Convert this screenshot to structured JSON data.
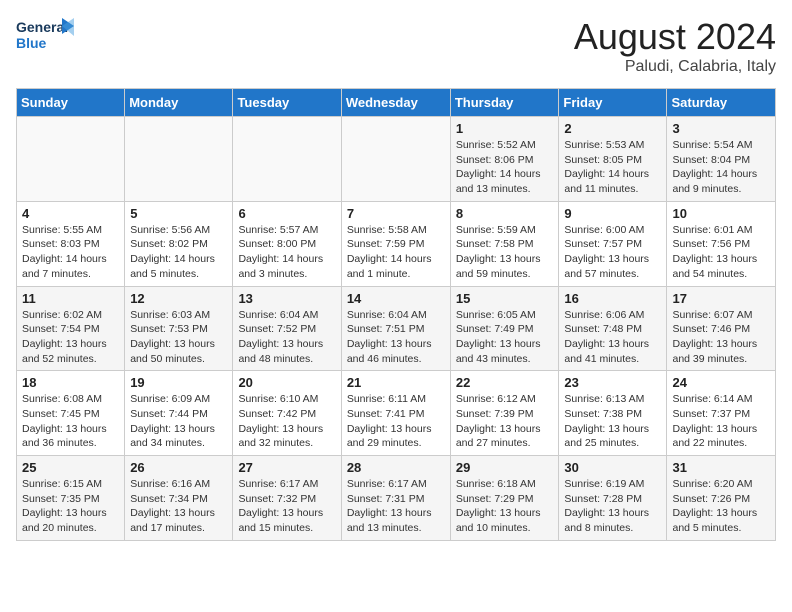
{
  "header": {
    "logo_general": "General",
    "logo_blue": "Blue",
    "month_title": "August 2024",
    "location": "Paludi, Calabria, Italy"
  },
  "weekdays": [
    "Sunday",
    "Monday",
    "Tuesday",
    "Wednesday",
    "Thursday",
    "Friday",
    "Saturday"
  ],
  "weeks": [
    [
      {
        "day": "",
        "info": ""
      },
      {
        "day": "",
        "info": ""
      },
      {
        "day": "",
        "info": ""
      },
      {
        "day": "",
        "info": ""
      },
      {
        "day": "1",
        "info": "Sunrise: 5:52 AM\nSunset: 8:06 PM\nDaylight: 14 hours\nand 13 minutes."
      },
      {
        "day": "2",
        "info": "Sunrise: 5:53 AM\nSunset: 8:05 PM\nDaylight: 14 hours\nand 11 minutes."
      },
      {
        "day": "3",
        "info": "Sunrise: 5:54 AM\nSunset: 8:04 PM\nDaylight: 14 hours\nand 9 minutes."
      }
    ],
    [
      {
        "day": "4",
        "info": "Sunrise: 5:55 AM\nSunset: 8:03 PM\nDaylight: 14 hours\nand 7 minutes."
      },
      {
        "day": "5",
        "info": "Sunrise: 5:56 AM\nSunset: 8:02 PM\nDaylight: 14 hours\nand 5 minutes."
      },
      {
        "day": "6",
        "info": "Sunrise: 5:57 AM\nSunset: 8:00 PM\nDaylight: 14 hours\nand 3 minutes."
      },
      {
        "day": "7",
        "info": "Sunrise: 5:58 AM\nSunset: 7:59 PM\nDaylight: 14 hours\nand 1 minute."
      },
      {
        "day": "8",
        "info": "Sunrise: 5:59 AM\nSunset: 7:58 PM\nDaylight: 13 hours\nand 59 minutes."
      },
      {
        "day": "9",
        "info": "Sunrise: 6:00 AM\nSunset: 7:57 PM\nDaylight: 13 hours\nand 57 minutes."
      },
      {
        "day": "10",
        "info": "Sunrise: 6:01 AM\nSunset: 7:56 PM\nDaylight: 13 hours\nand 54 minutes."
      }
    ],
    [
      {
        "day": "11",
        "info": "Sunrise: 6:02 AM\nSunset: 7:54 PM\nDaylight: 13 hours\nand 52 minutes."
      },
      {
        "day": "12",
        "info": "Sunrise: 6:03 AM\nSunset: 7:53 PM\nDaylight: 13 hours\nand 50 minutes."
      },
      {
        "day": "13",
        "info": "Sunrise: 6:04 AM\nSunset: 7:52 PM\nDaylight: 13 hours\nand 48 minutes."
      },
      {
        "day": "14",
        "info": "Sunrise: 6:04 AM\nSunset: 7:51 PM\nDaylight: 13 hours\nand 46 minutes."
      },
      {
        "day": "15",
        "info": "Sunrise: 6:05 AM\nSunset: 7:49 PM\nDaylight: 13 hours\nand 43 minutes."
      },
      {
        "day": "16",
        "info": "Sunrise: 6:06 AM\nSunset: 7:48 PM\nDaylight: 13 hours\nand 41 minutes."
      },
      {
        "day": "17",
        "info": "Sunrise: 6:07 AM\nSunset: 7:46 PM\nDaylight: 13 hours\nand 39 minutes."
      }
    ],
    [
      {
        "day": "18",
        "info": "Sunrise: 6:08 AM\nSunset: 7:45 PM\nDaylight: 13 hours\nand 36 minutes."
      },
      {
        "day": "19",
        "info": "Sunrise: 6:09 AM\nSunset: 7:44 PM\nDaylight: 13 hours\nand 34 minutes."
      },
      {
        "day": "20",
        "info": "Sunrise: 6:10 AM\nSunset: 7:42 PM\nDaylight: 13 hours\nand 32 minutes."
      },
      {
        "day": "21",
        "info": "Sunrise: 6:11 AM\nSunset: 7:41 PM\nDaylight: 13 hours\nand 29 minutes."
      },
      {
        "day": "22",
        "info": "Sunrise: 6:12 AM\nSunset: 7:39 PM\nDaylight: 13 hours\nand 27 minutes."
      },
      {
        "day": "23",
        "info": "Sunrise: 6:13 AM\nSunset: 7:38 PM\nDaylight: 13 hours\nand 25 minutes."
      },
      {
        "day": "24",
        "info": "Sunrise: 6:14 AM\nSunset: 7:37 PM\nDaylight: 13 hours\nand 22 minutes."
      }
    ],
    [
      {
        "day": "25",
        "info": "Sunrise: 6:15 AM\nSunset: 7:35 PM\nDaylight: 13 hours\nand 20 minutes."
      },
      {
        "day": "26",
        "info": "Sunrise: 6:16 AM\nSunset: 7:34 PM\nDaylight: 13 hours\nand 17 minutes."
      },
      {
        "day": "27",
        "info": "Sunrise: 6:17 AM\nSunset: 7:32 PM\nDaylight: 13 hours\nand 15 minutes."
      },
      {
        "day": "28",
        "info": "Sunrise: 6:17 AM\nSunset: 7:31 PM\nDaylight: 13 hours\nand 13 minutes."
      },
      {
        "day": "29",
        "info": "Sunrise: 6:18 AM\nSunset: 7:29 PM\nDaylight: 13 hours\nand 10 minutes."
      },
      {
        "day": "30",
        "info": "Sunrise: 6:19 AM\nSunset: 7:28 PM\nDaylight: 13 hours\nand 8 minutes."
      },
      {
        "day": "31",
        "info": "Sunrise: 6:20 AM\nSunset: 7:26 PM\nDaylight: 13 hours\nand 5 minutes."
      }
    ]
  ]
}
